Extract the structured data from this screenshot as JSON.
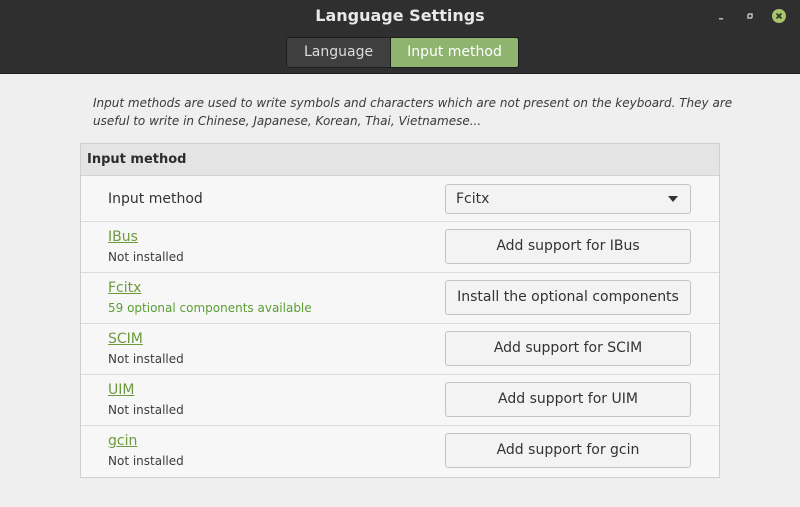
{
  "window": {
    "title": "Language Settings"
  },
  "tabs": [
    {
      "label": "Language",
      "active": false
    },
    {
      "label": "Input method",
      "active": true
    }
  ],
  "description": "Input methods are used to write symbols and characters which are not present on the keyboard. They are useful to write in Chinese, Japanese, Korean, Thai, Vietnamese...",
  "section": {
    "title": "Input method",
    "selector": {
      "label": "Input method",
      "value": "Fcitx"
    },
    "methods": [
      {
        "name": "IBus",
        "status": "Not installed",
        "action": "Add support for IBus"
      },
      {
        "name": "Fcitx",
        "status": "59 optional components available",
        "action": "Install the optional components"
      },
      {
        "name": "SCIM",
        "status": "Not installed",
        "action": "Add support for SCIM"
      },
      {
        "name": "UIM",
        "status": "Not installed",
        "action": "Add support for UIM"
      },
      {
        "name": "gcin",
        "status": "Not installed",
        "action": "Add support for gcin"
      }
    ]
  },
  "colors": {
    "accent": "#8fb46f",
    "link": "#6d9a3e",
    "status_available": "#5a9e32"
  },
  "icons": {
    "minimize": "minimize-icon",
    "maximize": "maximize-icon",
    "close": "close-icon"
  }
}
